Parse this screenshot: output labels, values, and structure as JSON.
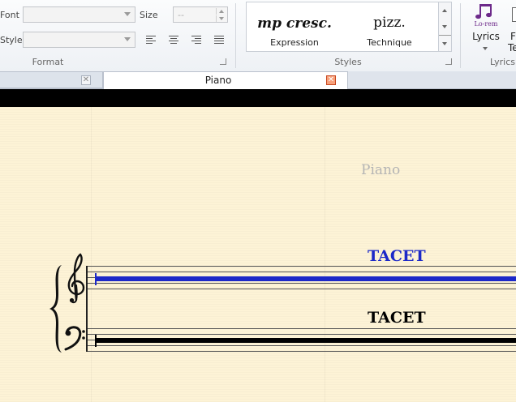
{
  "ribbon": {
    "format": {
      "font_label": "Font",
      "size_label": "Size",
      "size_value": "--",
      "style_label": "Style",
      "group_label": "Format"
    },
    "styles": {
      "group_label": "Styles",
      "items": [
        {
          "sample": "mp cresc.",
          "caption": "Expression"
        },
        {
          "sample": "pizz.",
          "caption": "Technique"
        }
      ]
    },
    "lyrics": {
      "icon_text": "Lo-rem",
      "label": "Lyrics",
      "group_label": "Lyrics",
      "next_partial_line1": "F",
      "next_partial_line2": "Te"
    }
  },
  "tabs": {
    "active": "Piano"
  },
  "score": {
    "instrument_name": "Piano",
    "tacet_upper": "TACET",
    "tacet_lower": "TACET",
    "colors": {
      "selected": "#1c28c8",
      "normal": "#000000",
      "name_grey": "#b4b4b4"
    }
  }
}
